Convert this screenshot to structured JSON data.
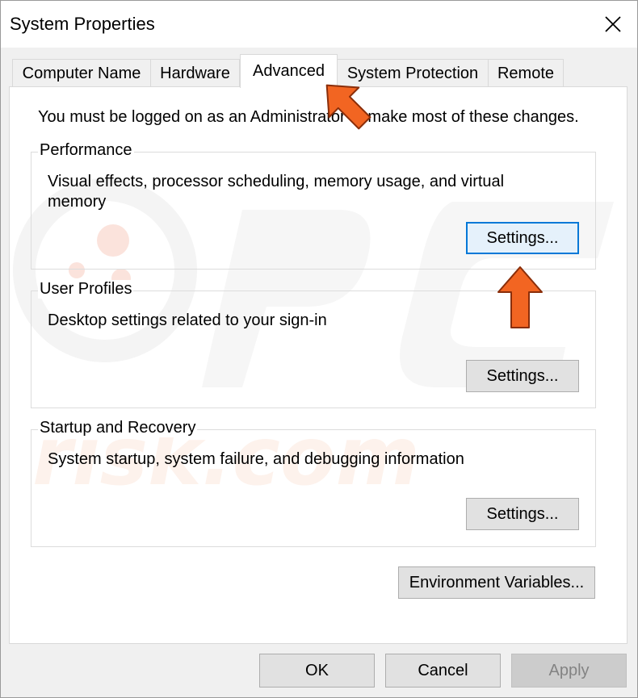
{
  "window": {
    "title": "System Properties",
    "close_icon": "close-icon"
  },
  "tabs": [
    {
      "label": "Computer Name",
      "active": false
    },
    {
      "label": "Hardware",
      "active": false
    },
    {
      "label": "Advanced",
      "active": true
    },
    {
      "label": "System Protection",
      "active": false
    },
    {
      "label": "Remote",
      "active": false
    }
  ],
  "advanced": {
    "notice": "You must be logged on as an Administrator to make most of these changes.",
    "performance": {
      "label": "Performance",
      "description": "Visual effects, processor scheduling, memory usage, and virtual memory",
      "button": "Settings..."
    },
    "user_profiles": {
      "label": "User Profiles",
      "description": "Desktop settings related to your sign-in",
      "button": "Settings..."
    },
    "startup_recovery": {
      "label": "Startup and Recovery",
      "description": "System startup, system failure, and debugging information",
      "button": "Settings..."
    },
    "env_button": "Environment Variables..."
  },
  "footer": {
    "ok": "OK",
    "cancel": "Cancel",
    "apply": "Apply"
  },
  "annotations": {
    "arrow_color": "#f26522",
    "watermark_text": "risk.com"
  },
  "colors": {
    "focus_border": "#0078d7",
    "button_face": "#e1e1e1"
  }
}
